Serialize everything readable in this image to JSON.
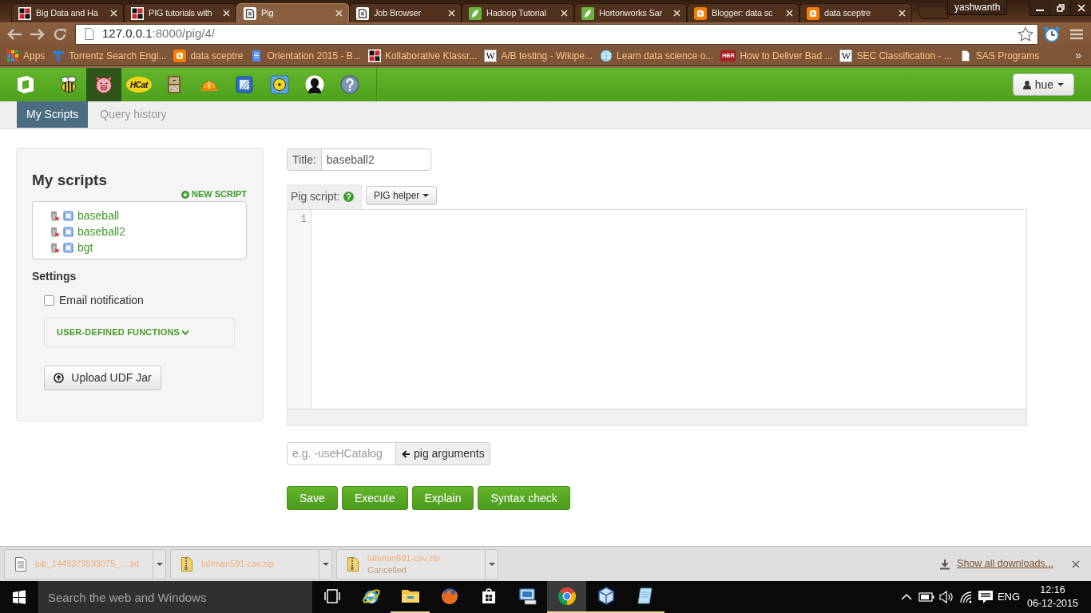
{
  "browser": {
    "tabs": [
      {
        "title": "Big Data and Ha",
        "kind": "kk",
        "selected": false
      },
      {
        "title": "PIG tutorials with",
        "kind": "kk",
        "selected": false
      },
      {
        "title": "Pig",
        "kind": "hue",
        "selected": true
      },
      {
        "title": "Job Browser",
        "kind": "hue",
        "selected": false
      },
      {
        "title": "Hadoop Tutorial",
        "kind": "leaf",
        "selected": false
      },
      {
        "title": "Hortonworks Sar",
        "kind": "leaf",
        "selected": false
      },
      {
        "title": "Blogger: data sc",
        "kind": "blog",
        "selected": false
      },
      {
        "title": "data sceptre",
        "kind": "blog",
        "selected": false
      }
    ],
    "profile": "yashwanth",
    "address": {
      "host": "127.0.0.1",
      "path": ":8000/pig/4/"
    },
    "bookmarks": [
      {
        "label": "Apps",
        "kind": "grid"
      },
      {
        "label": "Torrentz Search Engi...",
        "kind": "tee"
      },
      {
        "label": "data sceptre",
        "kind": "blog"
      },
      {
        "label": "Orientation 2015 - B...",
        "kind": "doc"
      },
      {
        "label": "Kollaborative Klassr...",
        "kind": "kk"
      },
      {
        "label": "A/B testing - Wikipe...",
        "kind": "letter",
        "logo": "W"
      },
      {
        "label": "Learn data science o...",
        "kind": "globe"
      },
      {
        "label": "How to Deliver Bad ...",
        "kind": "tag",
        "logo": "HBR"
      },
      {
        "label": "SEC Classification - ...",
        "kind": "letter",
        "logo": "W"
      },
      {
        "label": "SAS Programs",
        "kind": "page"
      }
    ],
    "bookmarks_more": "»"
  },
  "hue": {
    "apps": [
      {
        "kind": "bee",
        "selected": false
      },
      {
        "kind": "pig",
        "selected": true
      },
      {
        "kind": "hcat",
        "label": "HCat",
        "selected": false
      },
      {
        "kind": "cabinet",
        "selected": false
      },
      {
        "kind": "hardhat",
        "selected": false
      },
      {
        "kind": "pen",
        "selected": false
      },
      {
        "kind": "disc",
        "selected": false
      },
      {
        "kind": "silhouette",
        "selected": false
      },
      {
        "kind": "help",
        "selected": false
      }
    ],
    "user_menu": "hue",
    "subnav": [
      {
        "label": "My Scripts",
        "selected": true
      },
      {
        "label": "Query history",
        "selected": false
      }
    ],
    "scripts_panel": {
      "heading": "My scripts",
      "new_script": "NEW SCRIPT",
      "scripts": [
        "baseball",
        "baseball2",
        "bgt"
      ],
      "settings_heading": "Settings",
      "email_notification": {
        "label": "Email notification",
        "checked": false
      },
      "udf_toggle": "USER-DEFINED FUNCTIONS",
      "upload_button": "Upload UDF Jar"
    },
    "editor": {
      "title_label": "Title:",
      "title_value": "baseball2",
      "script_label": "Pig script:",
      "helper_button": "PIG helper",
      "line_numbers": [
        "1"
      ],
      "arguments_placeholder": "e.g. -useHCatalog",
      "arguments_button": "pig arguments"
    },
    "actions": [
      "Save",
      "Execute",
      "Explain",
      "Syntax check"
    ]
  },
  "downloads": {
    "items": [
      {
        "name": "job_1449379533075_....txt",
        "kind": "text"
      },
      {
        "name": "lahman591-csv.zip",
        "kind": "zip"
      },
      {
        "name": "lahman591-csv.zip",
        "kind": "zip",
        "status": "Cancelled"
      }
    ],
    "show_all": "Show all downloads..."
  },
  "taskbar": {
    "search_placeholder": "Search the web and Windows",
    "apps": [
      {
        "kind": "taskview",
        "running": false,
        "active": false
      },
      {
        "kind": "eglobe",
        "running": false,
        "active": false
      },
      {
        "kind": "folder",
        "running": true,
        "active": false
      },
      {
        "kind": "fox",
        "running": false,
        "active": false
      },
      {
        "kind": "bag",
        "running": false,
        "active": false
      },
      {
        "kind": "monitor",
        "running": false,
        "active": false
      },
      {
        "kind": "ring",
        "running": true,
        "active": true
      },
      {
        "kind": "cube",
        "running": true,
        "active": false
      },
      {
        "kind": "notepad",
        "running": true,
        "active": false
      }
    ],
    "language": "ENG",
    "time": "12:16",
    "date": "06-12-2015"
  }
}
